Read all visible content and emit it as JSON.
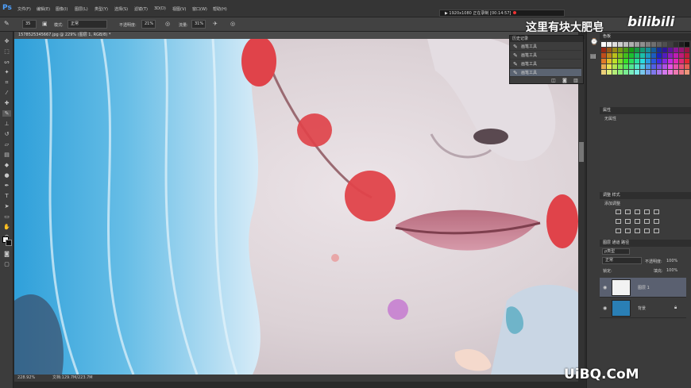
{
  "app": {
    "logo": "Ps"
  },
  "menu": [
    "文件(F)",
    "编辑(E)",
    "图像(I)",
    "图层(L)",
    "类型(Y)",
    "选择(S)",
    "滤镜(T)",
    "3D(D)",
    "视图(V)",
    "窗口(W)",
    "帮助(H)"
  ],
  "recorder": {
    "text": "▶ 1920x1080  正在录制 [00:14:57]"
  },
  "watermark": {
    "text": "这里有块大肥皂",
    "logo": "bilibili"
  },
  "options": {
    "brush_size": "35",
    "mode_label": "模式:",
    "mode_value": "正常",
    "opacity_label": "不透明度:",
    "opacity_value": "21%",
    "flow_label": "流量:",
    "flow_value": "31%"
  },
  "document": {
    "tab_title": "1578525345667.jpg @ 229% (图层 1, RGB/8) *"
  },
  "status": {
    "zoom": "228.92%",
    "doc": "文档:129.7M/223.7M"
  },
  "history": {
    "header": "历史记录",
    "items": [
      "画笔工具",
      "画笔工具",
      "画笔工具",
      "画笔工具"
    ],
    "selected_index": 3
  },
  "panels": {
    "swatches_tab": "色板",
    "properties_tab": "属性",
    "properties_text": "无属性",
    "adjustments_tab": "调整  样式",
    "adjustments_label": "添加调整",
    "layers_tab": "图层  通道  路径",
    "kind_label": "ρ类型",
    "blend_mode": "正常",
    "opacity_label": "不透明度:",
    "opacity_value": "100%",
    "lock_label": "锁定:",
    "fill_label": "填充:",
    "fill_value": "100%"
  },
  "layers": [
    {
      "name": "图层 1",
      "selected": true
    },
    {
      "name": "背景",
      "selected": false
    }
  ],
  "site_watermark": "UiBQ.CoM",
  "colors": {
    "accent": "#4ea1ff",
    "record_red": "#e33333",
    "dot_red": "#e0434a",
    "hair_blue": "#66bde6"
  }
}
